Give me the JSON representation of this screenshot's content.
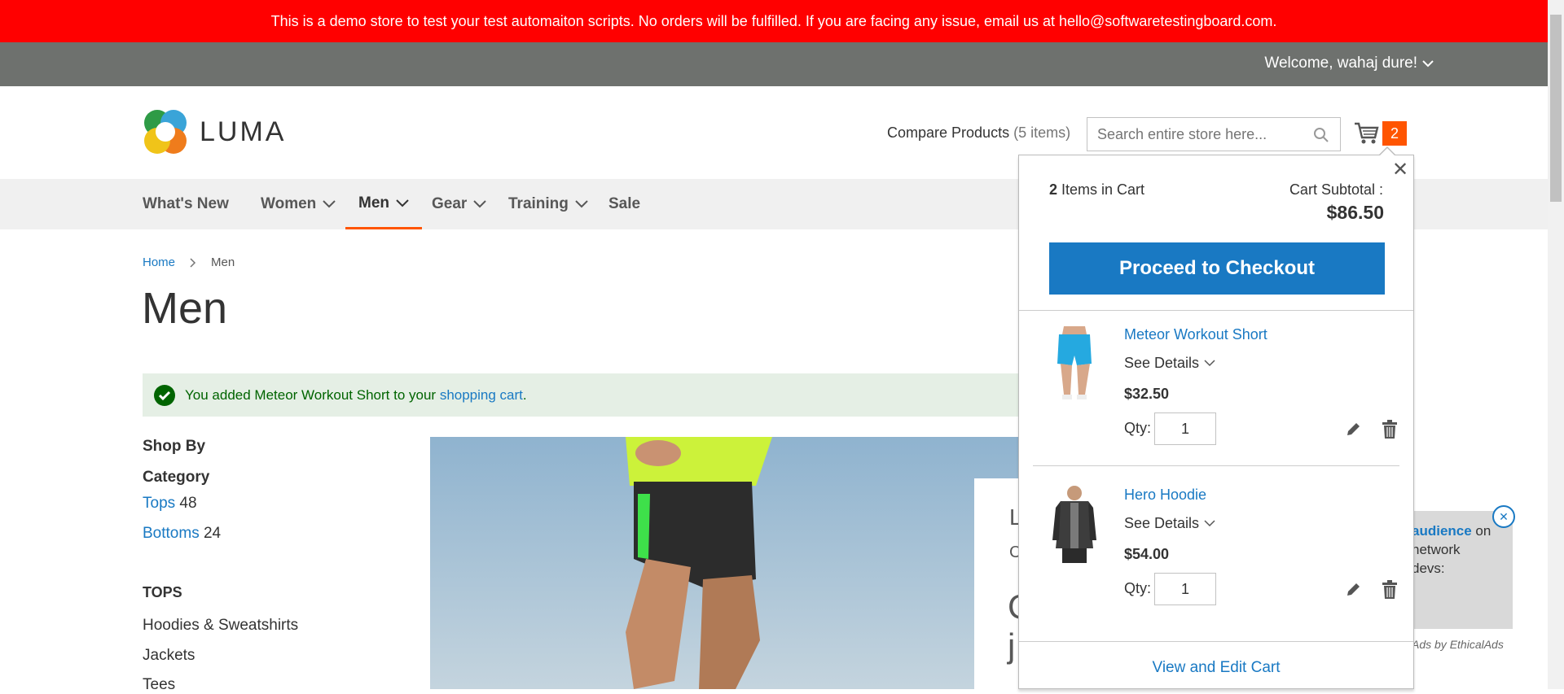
{
  "demo_notice": "This is a demo store to test your test automaiton scripts. No orders will be fulfilled. If you are facing any issue, email us at hello@softwaretestingboard.com.",
  "panel": {
    "welcome": "Welcome, wahaj dure!"
  },
  "header": {
    "logo_text": "LUMA",
    "compare_label": "Compare Products",
    "compare_count": "(5 items)",
    "search_placeholder": "Search entire store here...",
    "cart_count": "2"
  },
  "nav": {
    "items": [
      {
        "label": "What's New"
      },
      {
        "label": "Women"
      },
      {
        "label": "Men"
      },
      {
        "label": "Gear"
      },
      {
        "label": "Training"
      },
      {
        "label": "Sale"
      }
    ]
  },
  "breadcrumb": {
    "home": "Home",
    "current": "Men"
  },
  "page_title": "Men",
  "message": {
    "text_before": "You added Meteor Workout Short to your ",
    "link": "shopping cart",
    "text_after": "."
  },
  "sidebar": {
    "shop_by": "Shop By",
    "category_title": "Category",
    "categories": [
      {
        "label": "Tops",
        "count": "48"
      },
      {
        "label": "Bottoms",
        "count": "24"
      }
    ],
    "tops_heading": "TOPS",
    "tops_links": [
      "Hoodies & Sweatshirts",
      "Jackets",
      "Tees"
    ]
  },
  "hero": {
    "line1": "L",
    "line2": "C",
    "line3": "C",
    "line4": "j"
  },
  "minicart": {
    "items_count": "2",
    "items_label": "Items in Cart",
    "subtotal_label": "Cart Subtotal :",
    "subtotal_value": "$86.50",
    "checkout_label": "Proceed to Checkout",
    "see_details": "See Details",
    "qty_label": "Qty:",
    "items": [
      {
        "name": "Meteor Workout Short",
        "price": "$32.50",
        "qty": "1"
      },
      {
        "name": "Hero Hoodie",
        "price": "$54.00",
        "qty": "1"
      }
    ],
    "view_cart": "View and Edit Cart"
  },
  "ad": {
    "highlight": "audience",
    "line1_rest": " on",
    "line2": "network",
    "line3": "devs:",
    "credit": "Ads by EthicalAds"
  },
  "colors": {
    "demo_bar": "#ff0000",
    "panel": "#6e716e",
    "accent": "#ff5501",
    "link": "#1979c3",
    "success_bg": "#e5efe5"
  }
}
